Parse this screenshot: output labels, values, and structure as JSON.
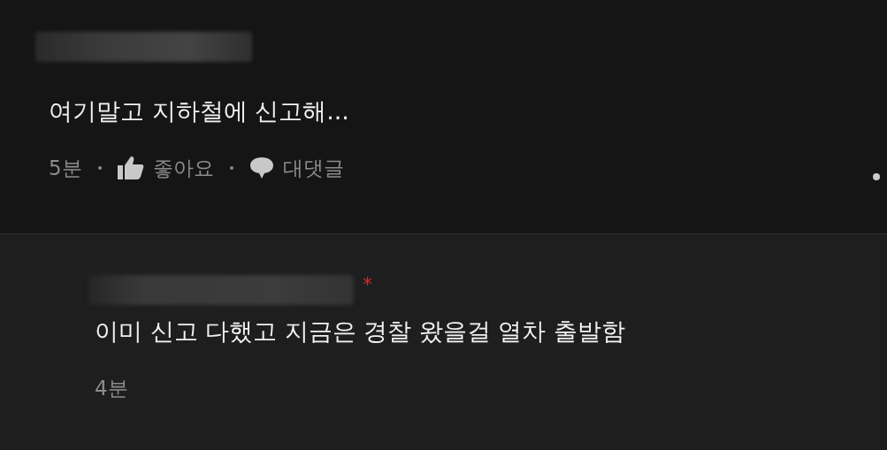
{
  "comments": [
    {
      "kind": "comment",
      "body": "여기말고 지하철에 신고해...",
      "time": "5분",
      "actions": [
        {
          "kind": "like",
          "label": "좋아요"
        },
        {
          "kind": "reply",
          "label": "대댓글"
        }
      ]
    },
    {
      "kind": "reply",
      "badge": "*",
      "body": "이미 신고 다했고 지금은 경찰 왔을걸 열차 출발함",
      "time": "4분"
    }
  ]
}
